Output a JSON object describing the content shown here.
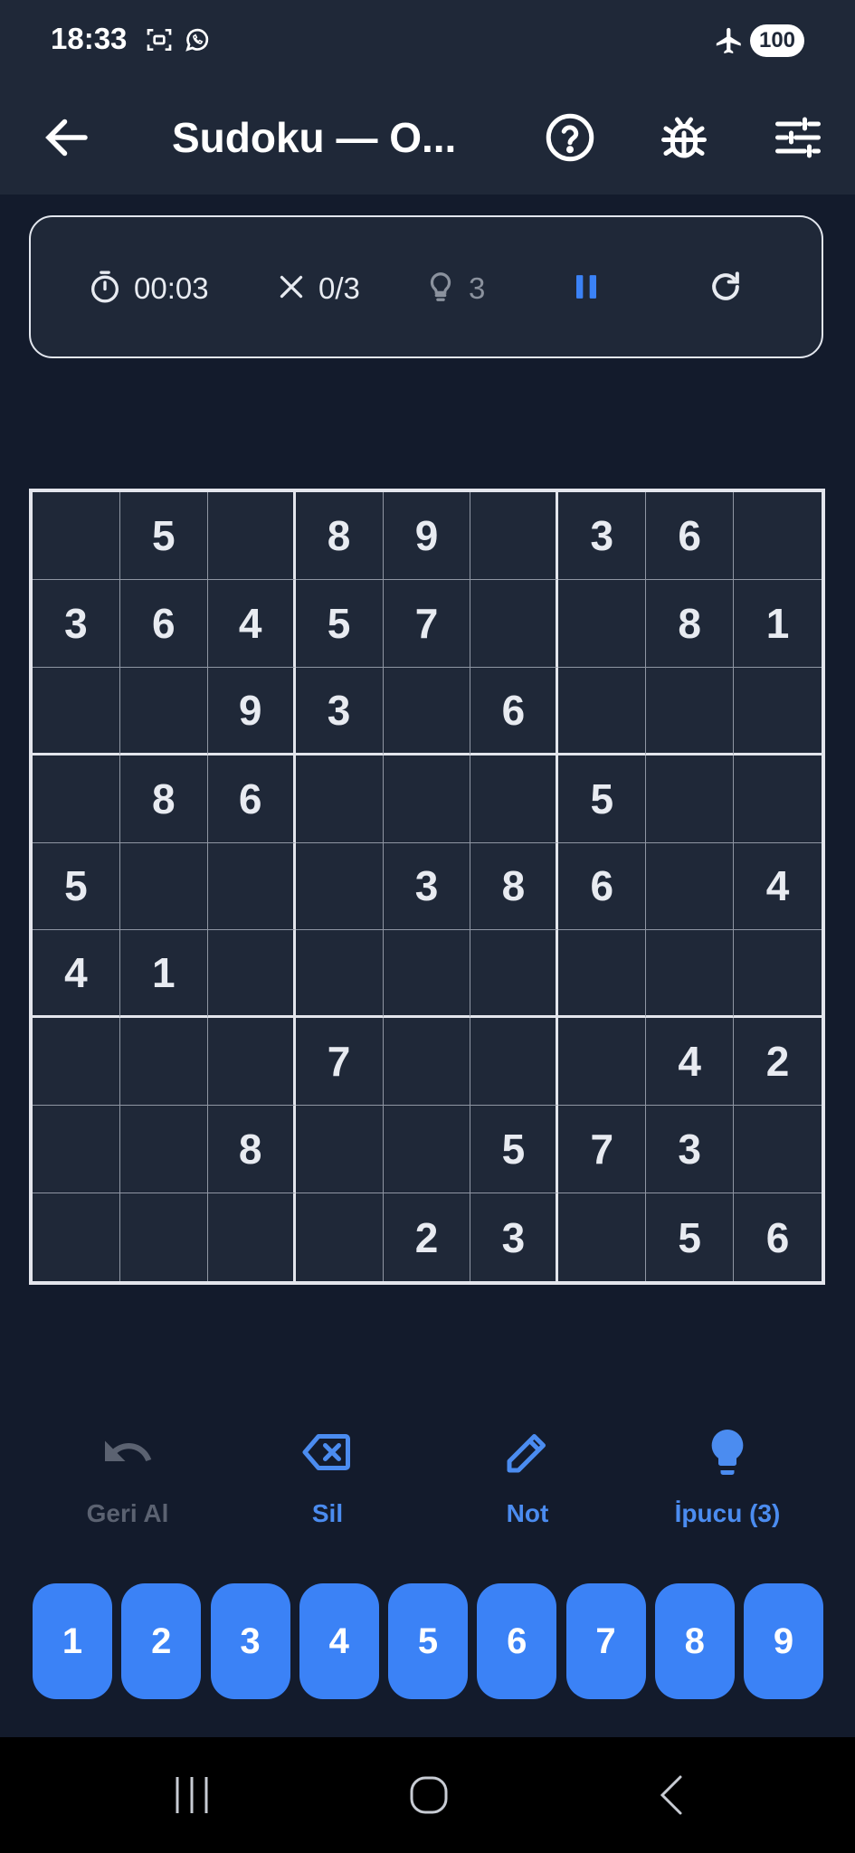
{
  "status_bar": {
    "time": "18:33",
    "battery": "100",
    "icons": [
      "screenshot-icon",
      "whatsapp-icon",
      "airplane-icon"
    ]
  },
  "app_bar": {
    "title": "Sudoku — O...",
    "icons": [
      "back-arrow-icon",
      "help-icon",
      "bug-icon",
      "settings-sliders-icon"
    ]
  },
  "info": {
    "timer": "00:03",
    "mistakes": "0/3",
    "hints": "3"
  },
  "board": {
    "cells": [
      [
        "",
        "5",
        "",
        "8",
        "9",
        "",
        "3",
        "6",
        ""
      ],
      [
        "3",
        "6",
        "4",
        "5",
        "7",
        "",
        "",
        "8",
        "1"
      ],
      [
        "",
        "",
        "9",
        "3",
        "",
        "6",
        "",
        "",
        ""
      ],
      [
        "",
        "8",
        "6",
        "",
        "",
        "",
        "5",
        "",
        ""
      ],
      [
        "5",
        "",
        "",
        "",
        "3",
        "8",
        "6",
        "",
        "4"
      ],
      [
        "4",
        "1",
        "",
        "",
        "",
        "",
        "",
        "",
        ""
      ],
      [
        "",
        "",
        "",
        "7",
        "",
        "",
        "",
        "4",
        "2"
      ],
      [
        "",
        "",
        "8",
        "",
        "",
        "5",
        "7",
        "3",
        ""
      ],
      [
        "",
        "",
        "",
        "",
        "2",
        "3",
        "",
        "5",
        "6"
      ]
    ]
  },
  "tools": {
    "undo": "Geri Al",
    "erase": "Sil",
    "note": "Not",
    "hint": "İpucu (3)"
  },
  "numpad": [
    "1",
    "2",
    "3",
    "4",
    "5",
    "6",
    "7",
    "8",
    "9"
  ],
  "colors": {
    "background": "#131b2c",
    "surface": "#1f2838",
    "accent": "#3b82f6",
    "accent_text": "#4b8cf0",
    "disabled": "#5b6271"
  }
}
